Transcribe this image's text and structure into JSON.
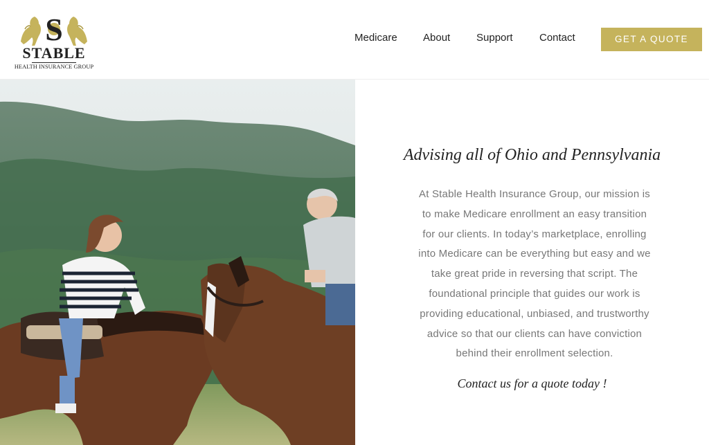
{
  "brand": {
    "logo_letter": "S",
    "logo_word": "STABLE",
    "logo_subtitle": "HEALTH INSURANCE GROUP",
    "gold": "#c5b35c"
  },
  "nav": {
    "items": [
      "Medicare",
      "About",
      "Support",
      "Contact"
    ],
    "cta_label": "GET A QUOTE"
  },
  "content": {
    "headline": "Advising all of Ohio and Pennsylvania",
    "body_lines": [
      "At Stable Health Insurance Group, our mission is",
      "to make Medicare enrollment an easy transition",
      "for our clients. In today’s marketplace, enrolling",
      "into Medicare can be everything but easy and we",
      "take great pride in reversing that script. The",
      "foundational principle that guides our work is",
      "providing educational, unbiased, and trustworthy",
      "advice so that our clients can have conviction",
      "behind their enrollment selection."
    ],
    "contact_line": "Contact us for a quote today !"
  }
}
